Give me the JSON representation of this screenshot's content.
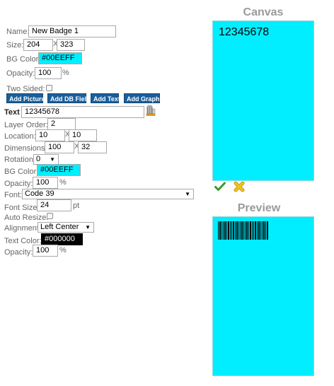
{
  "badge": {
    "name_label": "Name:",
    "name_value": "New Badge 1",
    "size_label": "Size:",
    "size_w": "204",
    "size_h": "323",
    "size_sep": "X",
    "bg_label": "BG Color:",
    "bg_value": "#00EEFF",
    "opacity_label": "Opacity:",
    "opacity_value": "100",
    "opacity_unit": "%",
    "two_sided_label": "Two Sided:"
  },
  "add_buttons": {
    "picture": "Add Picture",
    "db_field": "Add DB Field",
    "text": "Add Text",
    "graphic": "Add Graphic"
  },
  "layer": {
    "header_label": "Text",
    "text_value": "12345678",
    "order_label": "Layer Order:",
    "order_value": "2",
    "location_label": "Location:",
    "loc_x": "10",
    "loc_y": "10",
    "loc_sep": "X",
    "dimensions_label": "Dimensions:",
    "dim_w": "100",
    "dim_h": "32",
    "dim_sep": "X",
    "rotation_label": "Rotation:",
    "rotation_value": "0",
    "bg_label": "BG Color:",
    "bg_value": "#00EEFF",
    "opacity_label": "Opacity:",
    "opacity_value": "100",
    "opacity_unit": "%",
    "font_label": "Font:",
    "font_value": "Code 39",
    "font_size_label": "Font Size:",
    "font_size_value": "24",
    "font_size_unit": "pt",
    "auto_resize_label": "Auto Resize:",
    "alignment_label": "Alignment:",
    "alignment_value": "Left Center",
    "text_color_label": "Text Color:",
    "text_color_value": "#000000",
    "opacity2_label": "Opacity:",
    "opacity2_value": "100",
    "opacity2_unit": "%"
  },
  "canvas": {
    "title": "Canvas",
    "text": "12345678"
  },
  "preview": {
    "title": "Preview"
  },
  "colors": {
    "badge_bg": "#00EEFF",
    "button_bg": "#1A5F9C",
    "title_gray": "#9A9A9A",
    "accept_green": "#3a9a2a",
    "cancel_yellow": "#f2c21b"
  },
  "icons": {
    "db_icon": "database-icon",
    "accept": "checkmark-icon",
    "cancel": "x-icon"
  }
}
